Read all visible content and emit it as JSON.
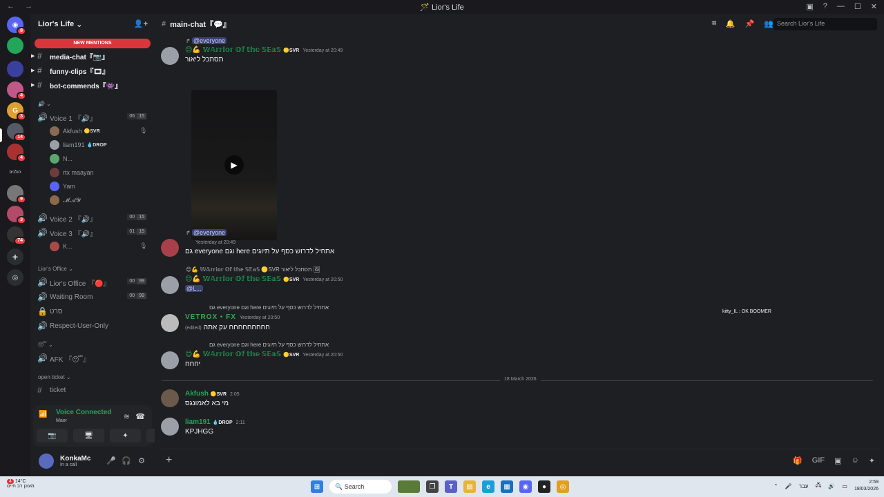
{
  "window": {
    "title": "Lior's Life"
  },
  "server": {
    "name": "Lior's Life",
    "new_mentions": "NEW MENTIONS"
  },
  "server_rail": {
    "badges": [
      "8",
      "4",
      "3",
      "14",
      "4",
      "9",
      "3",
      "74"
    ],
    "label_text": "הולכים"
  },
  "channels": {
    "text": [
      {
        "name": "media-chat『📷』"
      },
      {
        "name": "funny-clips『🎞』"
      },
      {
        "name": "bot-commends『👾』"
      }
    ],
    "voice_category": "🔊 ⌄",
    "voice1": {
      "name": "Voice 1 『🔊』",
      "count_a": "06",
      "count_b": "15"
    },
    "voice1_users": [
      {
        "name": "Akfush",
        "tag": "🟡SVR"
      },
      {
        "name": "liam191",
        "tag": "💧DROP"
      },
      {
        "name": "N...",
        "tag": ""
      },
      {
        "name": "rtx maayan",
        "tag": ""
      },
      {
        "name": "Yam",
        "tag": ""
      },
      {
        "name": "𝓜𝓐𝓨",
        "tag": ""
      }
    ],
    "voice2": {
      "name": "Voice 2 『🔊』",
      "count_a": "00",
      "count_b": "15"
    },
    "voice3": {
      "name": "Voice 3 『🔊』",
      "count_a": "01",
      "count_b": "15"
    },
    "voice3_user": "K...",
    "office_category": "Lior's Office ⌄",
    "office": {
      "name": "Lior's Office 『🔴』",
      "count_a": "00",
      "count_b": "99"
    },
    "waiting": {
      "name": "Waiting Room",
      "count_a": "00",
      "count_b": "99"
    },
    "seret": "סרט",
    "respect": "Respect-User-Only",
    "afk_category": "😴 ⌄",
    "afk": "AFK 『😴』",
    "ticket_category": "open ticket ⌄",
    "ticket": "ticket"
  },
  "voice_panel": {
    "status": "Voice Connected",
    "sub": "Maor"
  },
  "user_panel": {
    "name": "KonkaMc",
    "status": "In a call"
  },
  "chat": {
    "channel": "main-chat『💬』",
    "search_placeholder": "Search Lior's Life",
    "messages": [
      {
        "reply": "@everyone",
        "user": "😊💪 𝕎𝔸𝕣𝕣𝕚𝕠𝕣 𝕆𝕗 𝕥𝕙𝕖 𝕊𝔼𝕒𝕊",
        "tag": "🟡SVR",
        "time": "Yesterday at 20:49",
        "text": "תסתכל ליאור"
      },
      {
        "reply": "@everyone",
        "user": "",
        "tag": "",
        "time": "Yesterday at 20:49",
        "text": "גם everyone וגם here אתחיל לדרוש כסף על תיוגים"
      },
      {
        "reply": "😊💪 𝕎𝔸𝕣𝕣𝕚𝕠𝕣 𝕆𝕗 𝕥𝕙𝕖 𝕊𝔼𝕒𝕊 🟡SVR תסתכל ליאור 🖼",
        "user": "😊💪 𝕎𝔸𝕣𝕣𝕚𝕠𝕣 𝕆𝕗 𝕥𝕙𝕖 𝕊𝔼𝕒𝕊",
        "tag": "🟡SVR",
        "time": "Yesterday at 20:50",
        "text": "@L..."
      },
      {
        "reply": "גם everyone וגם here אתחיל לדרוש כסף על תיוגים",
        "user": "VETROX • FX",
        "tag": "",
        "time": "Yesterday at 20:50",
        "text": "חחחחחחחחח עק אתה",
        "edited": "(edited)"
      },
      {
        "reply": "גם everyone וגם here אתחיל לדרוש כסף על תיוגים",
        "user": "😊💪 𝕎𝔸𝕣𝕣𝕚𝕠𝕣 𝕆𝕗 𝕥𝕙𝕖 𝕊𝔼𝕒𝕊",
        "tag": "🟡SVR",
        "time": "Yesterday at 20:50",
        "text": "יחחח"
      },
      {
        "user": "Akfush",
        "tag": "🟡SVR",
        "time": "2:05",
        "text": "מי בא לאמונגס"
      },
      {
        "user": "liam191",
        "tag": "💧DROP",
        "time": "2:11",
        "text": "KPJHGG"
      }
    ],
    "date_divider": "18 March 2026",
    "float_user": "kitty_IL : OK BOOMER"
  },
  "taskbar": {
    "weather_temp": "14°C",
    "weather_desc": "מעונן רב חיים",
    "search": "Search",
    "lang": "עבר",
    "time": "2:59",
    "date": "18/03/2026",
    "weather_badge": "4"
  }
}
